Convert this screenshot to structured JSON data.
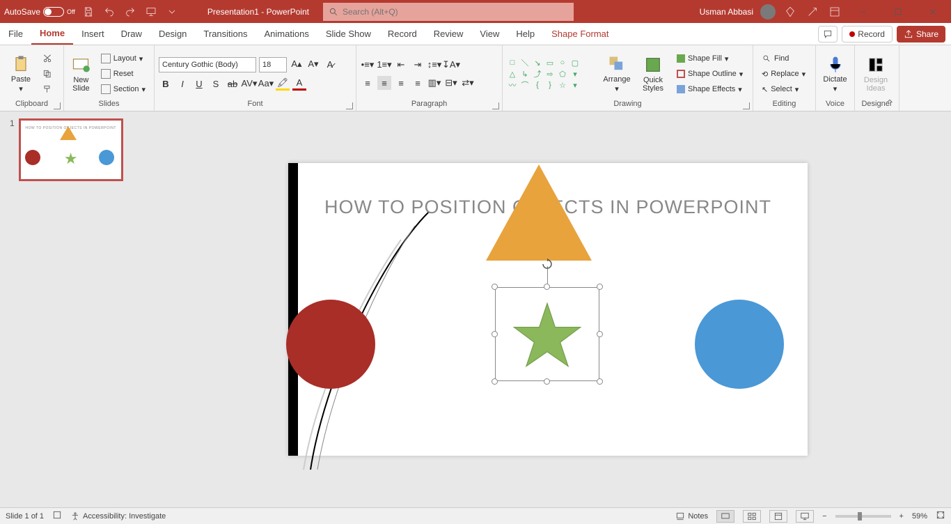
{
  "titlebar": {
    "autosave_label": "AutoSave",
    "autosave_state": "Off",
    "doc_title": "Presentation1 - PowerPoint",
    "search_placeholder": "Search (Alt+Q)",
    "username": "Usman Abbasi"
  },
  "tabs": {
    "items": [
      "File",
      "Home",
      "Insert",
      "Draw",
      "Design",
      "Transitions",
      "Animations",
      "Slide Show",
      "Record",
      "Review",
      "View",
      "Help"
    ],
    "context_tab": "Shape Format",
    "active": "Home",
    "record_btn": "Record",
    "share_btn": "Share"
  },
  "ribbon": {
    "clipboard": {
      "label": "Clipboard",
      "paste": "Paste"
    },
    "slides": {
      "label": "Slides",
      "new_slide": "New\nSlide",
      "layout": "Layout",
      "reset": "Reset",
      "section": "Section"
    },
    "font": {
      "label": "Font",
      "name": "Century Gothic (Body)",
      "size": "18"
    },
    "paragraph": {
      "label": "Paragraph"
    },
    "drawing": {
      "label": "Drawing",
      "arrange": "Arrange",
      "quick": "Quick\nStyles",
      "fill": "Shape Fill",
      "outline": "Shape Outline",
      "effects": "Shape Effects"
    },
    "editing": {
      "label": "Editing",
      "find": "Find",
      "replace": "Replace",
      "select": "Select"
    },
    "dictate": {
      "label": "Dictate"
    },
    "voice_label": "Voice",
    "designer": {
      "label": "Designer",
      "ideas": "Design\nIdeas"
    }
  },
  "thumb": {
    "number": "1",
    "title": "HOW TO POSITION OBJECTS  IN POWERPOINT"
  },
  "slide": {
    "title": "HOW TO POSITION OBJECTS  IN POWERPOINT"
  },
  "status": {
    "slide_of": "Slide 1 of 1",
    "accessibility": "Accessibility: Investigate",
    "notes": "Notes",
    "zoom_pct": "59%"
  }
}
